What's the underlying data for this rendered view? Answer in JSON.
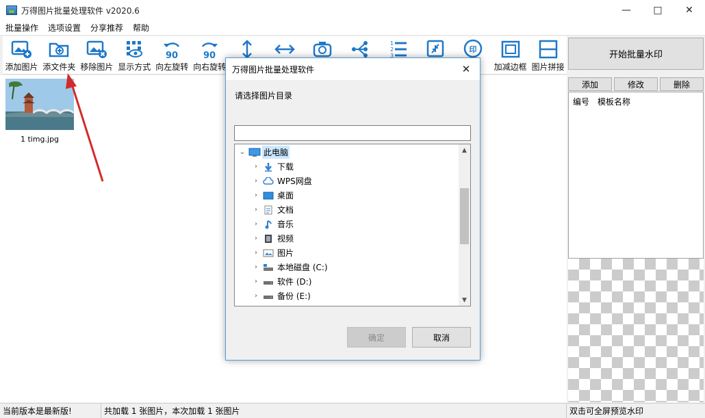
{
  "window": {
    "title": "万得图片批量处理软件 v2020.6"
  },
  "menu": [
    "批量操作",
    "选项设置",
    "分享推荐",
    "帮助"
  ],
  "toolbar": [
    {
      "label": "添加图片",
      "icon": "add-image-icon"
    },
    {
      "label": "添文件夹",
      "icon": "add-folder-icon"
    },
    {
      "label": "移除图片",
      "icon": "remove-image-icon"
    },
    {
      "label": "显示方式",
      "icon": "view-mode-icon"
    },
    {
      "label": "向左旋转",
      "icon": "rotate-left-icon"
    },
    {
      "label": "向右旋转",
      "icon": "rotate-right-icon"
    },
    {
      "label": "",
      "icon": "vertical-flip-icon"
    },
    {
      "label": "",
      "icon": "horizontal-flip-icon"
    },
    {
      "label": "",
      "icon": "camera-icon"
    },
    {
      "label": "",
      "icon": "share-icon"
    },
    {
      "label": "",
      "icon": "number-list-icon"
    },
    {
      "label": "",
      "icon": "compress-icon"
    },
    {
      "label": "水印",
      "icon": "watermark-icon"
    },
    {
      "label": "加减边框",
      "icon": "border-icon"
    },
    {
      "label": "图片拼接",
      "icon": "splice-icon"
    }
  ],
  "image_list": [
    {
      "name": "1 timg.jpg"
    }
  ],
  "right_panel": {
    "start_button": "开始批量水印",
    "add_button": "添加",
    "edit_button": "修改",
    "delete_button": "删除",
    "columns": [
      "编号",
      "模板名称"
    ]
  },
  "status": {
    "version": "当前版本是最新版!",
    "loaded": "共加载 1 张图片，本次加载 1 张图片",
    "hint": "双击可全屏预览水印"
  },
  "dialog": {
    "title": "万得图片批量处理软件",
    "prompt": "请选择图片目录",
    "path_value": "",
    "tree": [
      {
        "label": "此电脑",
        "icon": "computer-icon",
        "expanded": true,
        "level": 0,
        "selected": true
      },
      {
        "label": "下载",
        "icon": "download-icon",
        "level": 1
      },
      {
        "label": "WPS网盘",
        "icon": "cloud-icon",
        "level": 1
      },
      {
        "label": "桌面",
        "icon": "desktop-icon",
        "level": 1
      },
      {
        "label": "文档",
        "icon": "document-icon",
        "level": 1
      },
      {
        "label": "音乐",
        "icon": "music-icon",
        "level": 1
      },
      {
        "label": "视频",
        "icon": "video-icon",
        "level": 1
      },
      {
        "label": "图片",
        "icon": "picture-icon",
        "level": 1
      },
      {
        "label": "本地磁盘 (C:)",
        "icon": "system-drive-icon",
        "level": 1
      },
      {
        "label": "软件 (D:)",
        "icon": "drive-icon",
        "level": 1
      },
      {
        "label": "备份 (E:)",
        "icon": "drive-icon",
        "level": 1
      }
    ],
    "ok_button": "确定",
    "cancel_button": "取消"
  },
  "colors": {
    "accent": "#1e78c8",
    "arrow": "#d22a2a"
  }
}
